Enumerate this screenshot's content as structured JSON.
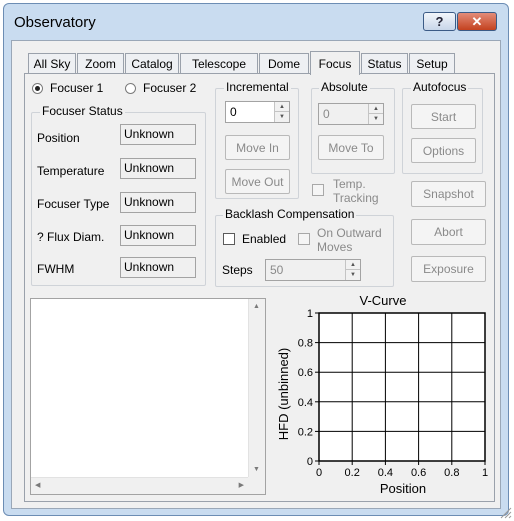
{
  "window": {
    "title": "Observatory",
    "help_icon": "question-mark-icon",
    "close_icon": "close-x-icon"
  },
  "tabs": [
    {
      "label": "All Sky"
    },
    {
      "label": "Zoom"
    },
    {
      "label": "Catalog"
    },
    {
      "label": "Telescope"
    },
    {
      "label": "Dome"
    },
    {
      "label": "Focus",
      "active": true
    },
    {
      "label": "Status"
    },
    {
      "label": "Setup"
    }
  ],
  "focuser_select": {
    "focuser1": "Focuser 1",
    "focuser2": "Focuser 2",
    "selected": "Focuser 1"
  },
  "focuser_status": {
    "title": "Focuser Status",
    "rows": [
      {
        "label": "Position",
        "value": "Unknown"
      },
      {
        "label": "Temperature",
        "value": "Unknown"
      },
      {
        "label": "Focuser Type",
        "value": "Unknown"
      },
      {
        "label": "? Flux Diam.",
        "value": "Unknown"
      },
      {
        "label": "FWHM",
        "value": "Unknown"
      }
    ]
  },
  "incremental": {
    "title": "Incremental",
    "value": "0",
    "move_in": "Move In",
    "move_out": "Move Out"
  },
  "absolute": {
    "title": "Absolute",
    "value": "0",
    "move_to": "Move To"
  },
  "temp_tracking": {
    "label_line1": "Temp.",
    "label_line2": "Tracking"
  },
  "autofocus": {
    "title": "Autofocus",
    "start": "Start",
    "options": "Options"
  },
  "right_buttons": {
    "snapshot": "Snapshot",
    "abort": "Abort",
    "exposure": "Exposure"
  },
  "backlash": {
    "title": "Backlash Compensation",
    "enabled_label": "Enabled",
    "outward_line1": "On Outward",
    "outward_line2": "Moves",
    "steps_label": "Steps",
    "steps_value": "50"
  },
  "chart_data": {
    "type": "line",
    "title": "V-Curve",
    "xlabel": "Position",
    "ylabel": "HFD (unbinned)",
    "xlim": [
      0,
      1
    ],
    "ylim": [
      0,
      1
    ],
    "x_ticks": [
      "0",
      "0.2",
      "0.4",
      "0.6",
      "0.8",
      "1"
    ],
    "y_ticks": [
      "0",
      "0.2",
      "0.4",
      "0.6",
      "0.8",
      "1"
    ],
    "grid": true,
    "series": []
  },
  "colors": {
    "window_frame": "#c9dcf0",
    "close_button": "#c4421f"
  }
}
